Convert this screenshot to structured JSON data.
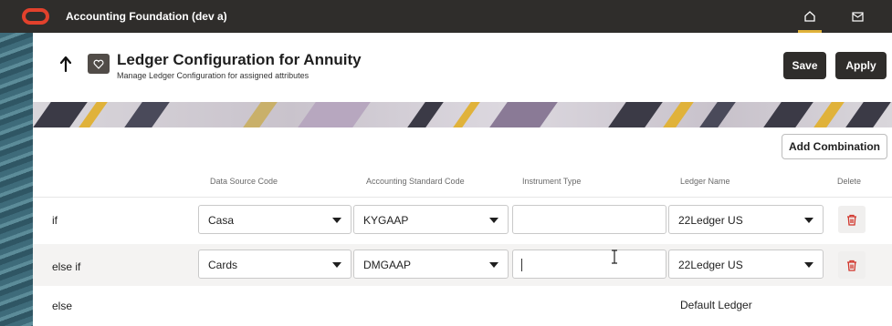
{
  "app": {
    "title": "Accounting Foundation (dev a)"
  },
  "header": {
    "title": "Ledger Configuration for Annuity",
    "subtitle": "Manage Ledger Configuration for assigned attributes",
    "save_label": "Save",
    "apply_label": "Apply"
  },
  "toolbar": {
    "add_combination_label": "Add Combination"
  },
  "columns": {
    "data_source_code": "Data Source Code",
    "accounting_standard_code": "Accounting Standard Code",
    "instrument_type": "Instrument Type",
    "ledger_name": "Ledger Name",
    "delete": "Delete"
  },
  "rows": [
    {
      "label": "if",
      "data_source": "Casa",
      "accounting_standard": "KYGAAP",
      "instrument_type": "",
      "ledger_name": "22Ledger US"
    },
    {
      "label": "else if",
      "data_source": "Cards",
      "accounting_standard": "DMGAAP",
      "instrument_type": "",
      "ledger_name": "22Ledger US"
    }
  ],
  "else_row": {
    "label": "else",
    "ledger_name": "Default Ledger"
  },
  "colors": {
    "topbar": "#2f2d2b",
    "oracle_red": "#e2412c",
    "delete_red": "#d1352b",
    "accent_gold": "#e0b23a"
  },
  "icons": [
    "oracle-logo",
    "home-icon",
    "message-icon",
    "back-arrow-icon",
    "heart-icon",
    "trash-icon",
    "chevron-down-icon",
    "text-cursor-icon"
  ]
}
